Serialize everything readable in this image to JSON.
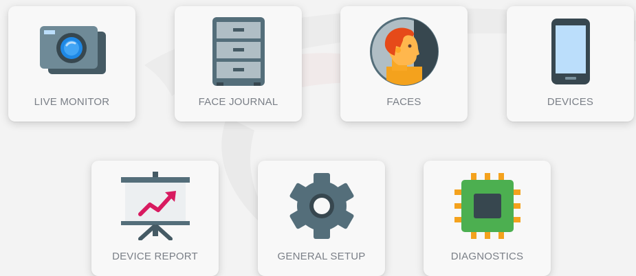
{
  "tiles": [
    {
      "label": "LIVE MONITOR",
      "icon": "camera-icon"
    },
    {
      "label": "FACE JOURNAL",
      "icon": "file-cabinet-icon"
    },
    {
      "label": "FACES",
      "icon": "face-profile-icon"
    },
    {
      "label": "DEVICES",
      "icon": "smartphone-icon"
    },
    {
      "label": "DEVICE REPORT",
      "icon": "presentation-chart-icon"
    },
    {
      "label": "GENERAL SETUP",
      "icon": "gear-icon"
    },
    {
      "label": "DIAGNOSTICS",
      "icon": "chip-icon"
    }
  ],
  "colors": {
    "background": "#f3f3f3",
    "tile": "#f8f8f8",
    "label": "#7a7f87",
    "icon_slate": "#5f7380",
    "accent_pink": "#d81b60",
    "accent_orange": "#f4a21d",
    "accent_green": "#4caf50"
  }
}
